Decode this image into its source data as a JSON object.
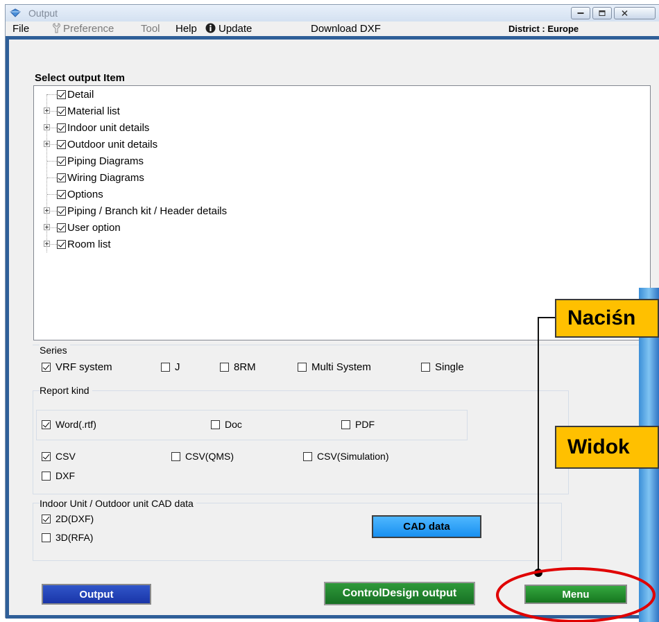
{
  "window": {
    "title": "Output",
    "controls": [
      "minimize",
      "maximize",
      "close"
    ]
  },
  "menubar": {
    "items": [
      {
        "label": "File",
        "disabled": false
      },
      {
        "label": "Preference",
        "disabled": true,
        "icon": "wrench-icon"
      },
      {
        "label": "Tool",
        "disabled": true
      },
      {
        "label": "Help",
        "disabled": false
      },
      {
        "label": "Update",
        "disabled": false,
        "icon": "info-icon"
      },
      {
        "label": "Download DXF",
        "disabled": false
      }
    ],
    "district": "District : Europe"
  },
  "select_output": {
    "title": "Select output Item",
    "items": [
      {
        "label": "Detail",
        "checked": true,
        "expandable": false
      },
      {
        "label": "Material list",
        "checked": true,
        "expandable": true
      },
      {
        "label": "Indoor unit details",
        "checked": true,
        "expandable": true
      },
      {
        "label": "Outdoor unit details",
        "checked": true,
        "expandable": true
      },
      {
        "label": "Piping Diagrams",
        "checked": true,
        "expandable": false
      },
      {
        "label": "Wiring Diagrams",
        "checked": true,
        "expandable": false
      },
      {
        "label": "Options",
        "checked": true,
        "expandable": false
      },
      {
        "label": "Piping / Branch kit / Header details",
        "checked": true,
        "expandable": true
      },
      {
        "label": "User option",
        "checked": true,
        "expandable": true
      },
      {
        "label": "Room list",
        "checked": true,
        "expandable": true
      }
    ]
  },
  "series": {
    "title": "Series",
    "options": [
      {
        "label": "VRF system",
        "checked": true
      },
      {
        "label": "J",
        "checked": false
      },
      {
        "label": "8RM",
        "checked": false
      },
      {
        "label": "Multi System",
        "checked": false
      },
      {
        "label": "Single",
        "checked": false
      }
    ]
  },
  "report_kind": {
    "title": "Report kind",
    "word": {
      "label": "Word(.rtf)",
      "checked": true
    },
    "doc": {
      "label": "Doc",
      "checked": false
    },
    "pdf": {
      "label": "PDF",
      "checked": false
    },
    "csv": {
      "label": "CSV",
      "checked": true
    },
    "csv_qms": {
      "label": "CSV(QMS)",
      "checked": false
    },
    "csv_sim": {
      "label": "CSV(Simulation)",
      "checked": false
    },
    "dxf": {
      "label": "DXF",
      "checked": false
    }
  },
  "cad": {
    "title": "Indoor Unit / Outdoor unit CAD data",
    "d2": {
      "label": "2D(DXF)",
      "checked": true
    },
    "d3": {
      "label": "3D(RFA)",
      "checked": false
    },
    "button": "CAD data"
  },
  "buttons": {
    "output": "Output",
    "control_design": "ControlDesign output",
    "menu": "Menu"
  },
  "annotations": {
    "callout_1": "Naciśn",
    "callout_2": "Widok"
  },
  "colors": {
    "frame_blue": "#2f5f98",
    "output_button": "#1f3fb4",
    "green_button": "#1f8a2c",
    "cad_button": "#2a9cf5",
    "callout_fill": "#ffc000",
    "highlight_ring": "#e00000"
  }
}
